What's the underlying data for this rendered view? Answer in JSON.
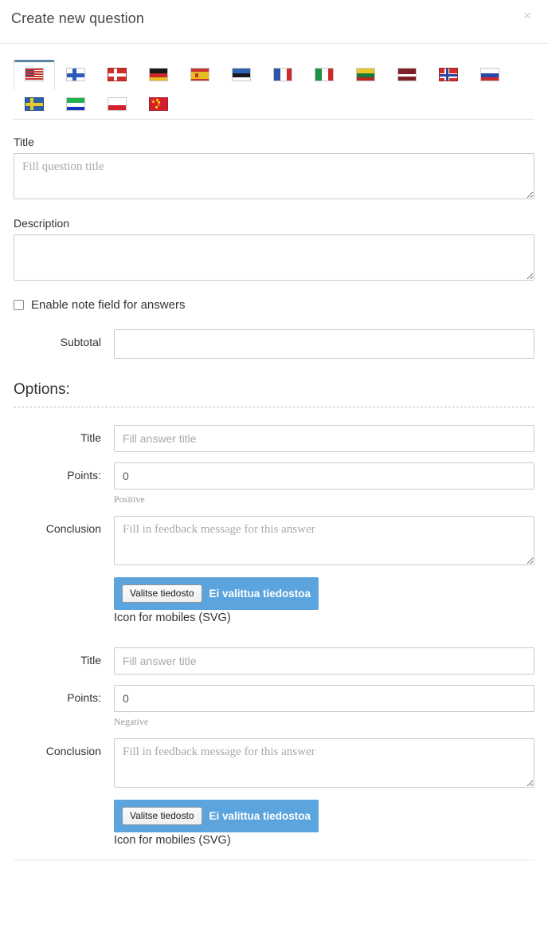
{
  "header": {
    "title": "Create new question",
    "close_label": "×"
  },
  "language_tabs": [
    {
      "code": "us",
      "label": "United States",
      "active": true
    },
    {
      "code": "fi",
      "label": "Finland",
      "active": false
    },
    {
      "code": "dk",
      "label": "Denmark",
      "active": false
    },
    {
      "code": "de",
      "label": "Germany",
      "active": false
    },
    {
      "code": "es",
      "label": "Spain",
      "active": false
    },
    {
      "code": "ee",
      "label": "Estonia",
      "active": false
    },
    {
      "code": "fr",
      "label": "France",
      "active": false
    },
    {
      "code": "it",
      "label": "Italy",
      "active": false
    },
    {
      "code": "lt",
      "label": "Lithuania",
      "active": false
    },
    {
      "code": "lv",
      "label": "Latvia",
      "active": false
    },
    {
      "code": "no",
      "label": "Norway",
      "active": false
    },
    {
      "code": "ru",
      "label": "Russia",
      "active": false
    },
    {
      "code": "se",
      "label": "Sweden",
      "active": false
    },
    {
      "code": "sl",
      "label": "Sierra Leone",
      "active": false
    },
    {
      "code": "pl",
      "label": "Poland",
      "active": false
    },
    {
      "code": "cn",
      "label": "China",
      "active": false
    }
  ],
  "question": {
    "title_label": "Title",
    "title_placeholder": "Fill question title",
    "title_value": "",
    "description_label": "Description",
    "description_placeholder": "",
    "description_value": "",
    "note_checkbox_label": "Enable note field for answers",
    "note_checkbox_checked": false,
    "subtotal_label": "Subtotal",
    "subtotal_placeholder": "",
    "subtotal_value": ""
  },
  "options": {
    "heading": "Options:",
    "answers": [
      {
        "title_label": "Title",
        "title_placeholder": "Fill answer title",
        "title_value": "",
        "points_label": "Points:",
        "points_value": "0",
        "points_helper": "Positive",
        "conclusion_label": "Conclusion",
        "conclusion_placeholder": "Fill in feedback message for this answer",
        "conclusion_value": "",
        "file_button_label": "Valitse tiedosto",
        "file_status_text": "Ei valittua tiedostoa",
        "file_caption": "Icon for mobiles (SVG)"
      },
      {
        "title_label": "Title",
        "title_placeholder": "Fill answer title",
        "title_value": "",
        "points_label": "Points:",
        "points_value": "0",
        "points_helper": "Negative",
        "conclusion_label": "Conclusion",
        "conclusion_placeholder": "Fill in feedback message for this answer",
        "conclusion_value": "",
        "file_button_label": "Valitse tiedosto",
        "file_status_text": "Ei valittua tiedostoa",
        "file_caption": "Icon for mobiles (SVG)"
      }
    ]
  },
  "colors": {
    "accent_blue": "#5ba4dd",
    "active_tab_border": "#5d87a1",
    "border_gray": "#cccccc",
    "text_dark": "#333333",
    "placeholder_gray": "#a9a9a9"
  }
}
